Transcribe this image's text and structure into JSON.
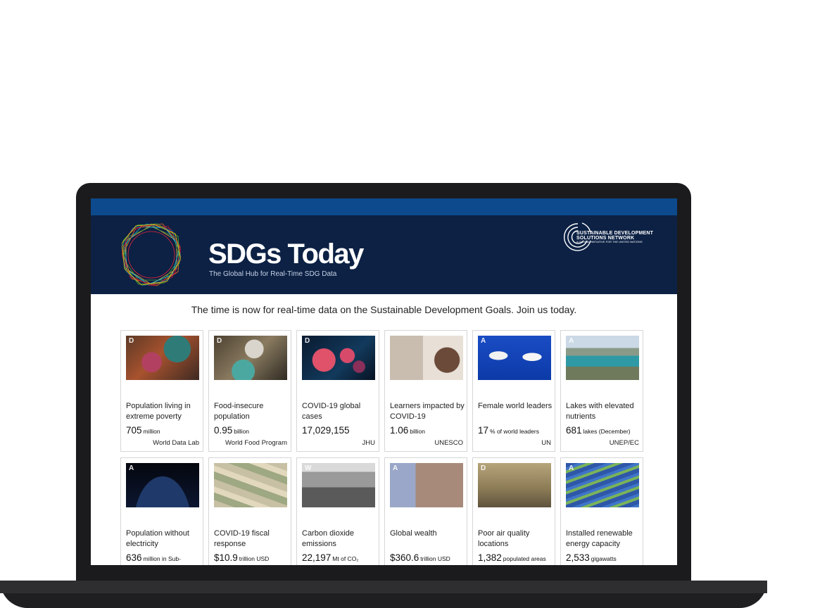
{
  "header": {
    "title": "SDGs Today",
    "subtitle": "The Global Hub for Real-Time SDG Data",
    "partner_line1": "SUSTAINABLE DEVELOPMENT",
    "partner_line2": "SOLUTIONS NETWORK",
    "partner_sub": "A GLOBAL INITIATIVE FOR THE UNITED NATIONS"
  },
  "tagline": "The time is now for real-time data on the Sustainable Development Goals. Join us today.",
  "colors": {
    "top_bar": "#0c4a8d",
    "hero_bg": "#0c2144"
  },
  "cards": [
    {
      "badge": "D",
      "title": "Population living in extreme poverty",
      "value": "705",
      "unit": "million",
      "source": "World Data Lab",
      "icon": "poverty-photo"
    },
    {
      "badge": "D",
      "title": "Food-insecure population",
      "value": "0.95",
      "unit": "billion",
      "source": "World Food Program",
      "icon": "food-photo"
    },
    {
      "badge": "D",
      "title": "COVID-19 global cases",
      "value": "17,029,155",
      "unit": "",
      "source": "JHU",
      "icon": "virus-photo"
    },
    {
      "badge": "",
      "title": "Learners impacted by COVID-19",
      "value": "1.06",
      "unit": "billion",
      "source": "UNESCO",
      "icon": "learner-photo"
    },
    {
      "badge": "A",
      "title": "Female world leaders",
      "value": "17",
      "unit": "% of world leaders",
      "source": "UN",
      "icon": "leaders-photo"
    },
    {
      "badge": "A",
      "title": "Lakes with elevated nutrients",
      "value": "681",
      "unit": "lakes (December)",
      "source": "UNEP/EC",
      "icon": "lake-photo"
    },
    {
      "badge": "A",
      "title": "Population without electricity",
      "value": "636",
      "unit": "million in Sub-",
      "source": "",
      "icon": "earth-night-photo"
    },
    {
      "badge": "",
      "title": "COVID-19 fiscal response",
      "value": "$10.9",
      "unit": "trillion USD",
      "source": "",
      "icon": "money-photo"
    },
    {
      "badge": "W",
      "title": "Carbon dioxide emissions",
      "value": "22,197",
      "unit": "Mt of CO₂",
      "source": "",
      "icon": "factory-photo"
    },
    {
      "badge": "A",
      "title": "Global wealth",
      "value": "$360.6",
      "unit": "trillion USD",
      "source": "",
      "icon": "city-photo"
    },
    {
      "badge": "D",
      "title": "Poor air quality locations",
      "value": "1,382",
      "unit": "populated areas",
      "source": "",
      "icon": "smog-photo"
    },
    {
      "badge": "A",
      "title": "Installed renewable energy capacity",
      "value": "2,533",
      "unit": "gigawatts",
      "source": "",
      "icon": "solar-photo"
    }
  ]
}
